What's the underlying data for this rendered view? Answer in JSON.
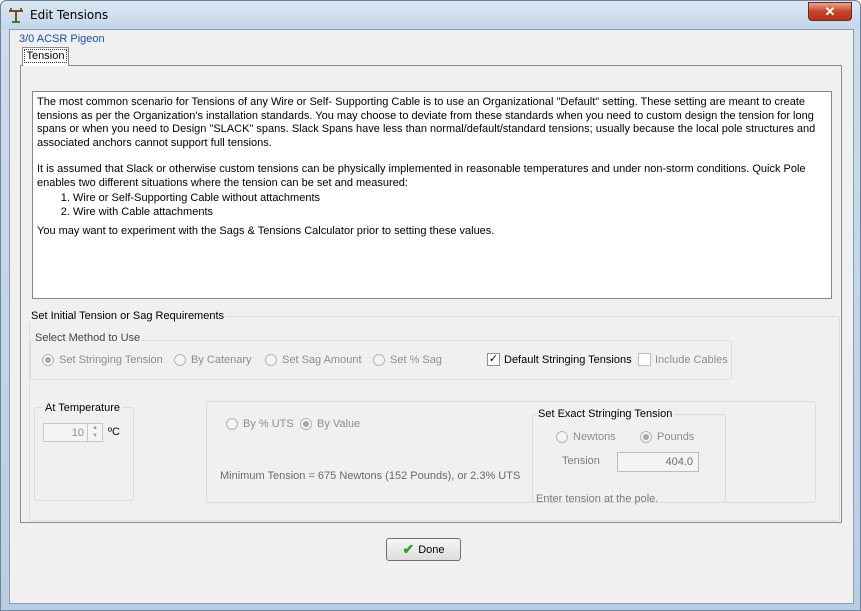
{
  "window": {
    "title": "Edit Tensions",
    "close_label": "✕"
  },
  "breadcrumb": "3/0 ACSR Pigeon",
  "tabs": [
    {
      "label": "Tension"
    }
  ],
  "info": {
    "p1": "The most common scenario for Tensions of any Wire or Self- Supporting Cable is to use an Organizational \"Default\" setting. These setting are meant to create tensions as per the Organization's installation standards. You may choose to deviate from these standards when you need to custom design the tension for long spans or when you need to Design \"SLACK\" spans. Slack Spans have less than normal/default/standard tensions; usually because the local pole structures and associated anchors cannot support full tensions.",
    "p2": "It is assumed that Slack or otherwise custom tensions can be physically implemented in reasonable temperatures and under non-storm conditions. Quick Pole enables two different situations where the tension can be set and measured:",
    "list": [
      "Wire or Self-Supporting Cable without attachments",
      "Wire with Cable attachments"
    ],
    "p3": "You may want to experiment with the Sags & Tensions Calculator prior to setting these values."
  },
  "requirements": {
    "group_label": "Set Initial Tension or Sag Requirements",
    "method_label": "Select Method to Use",
    "methods": [
      {
        "label": "Set Stringing Tension",
        "selected": true
      },
      {
        "label": "By Catenary",
        "selected": false
      },
      {
        "label": "Set Sag Amount",
        "selected": false
      },
      {
        "label": "Set % Sag",
        "selected": false
      }
    ],
    "default_tensions": {
      "label": "Default Stringing Tensions",
      "checked": true
    },
    "include_cables": {
      "label": "Include Cables",
      "checked": false
    }
  },
  "temperature": {
    "label": "At Temperature",
    "value": "10",
    "unit": "ºC"
  },
  "uts": {
    "by_uts_label": "By % UTS",
    "by_value_label": "By Value",
    "by_value_selected": true,
    "min_tension_text": "Minimum Tension = 675 Newtons (152 Pounds), or 2.3% UTS"
  },
  "exact": {
    "label": "Set Exact Stringing Tension",
    "newtons_label": "Newtons",
    "pounds_label": "Pounds",
    "pounds_selected": true,
    "tension_label": "Tension",
    "tension_value": "404.0",
    "hint": "Enter tension at the pole."
  },
  "done_label": "Done",
  "colors": {
    "title_bg": "#c4d6ea",
    "link": "#1a4fa8",
    "close": "#c4432b",
    "ok_check": "#2aa52a"
  }
}
